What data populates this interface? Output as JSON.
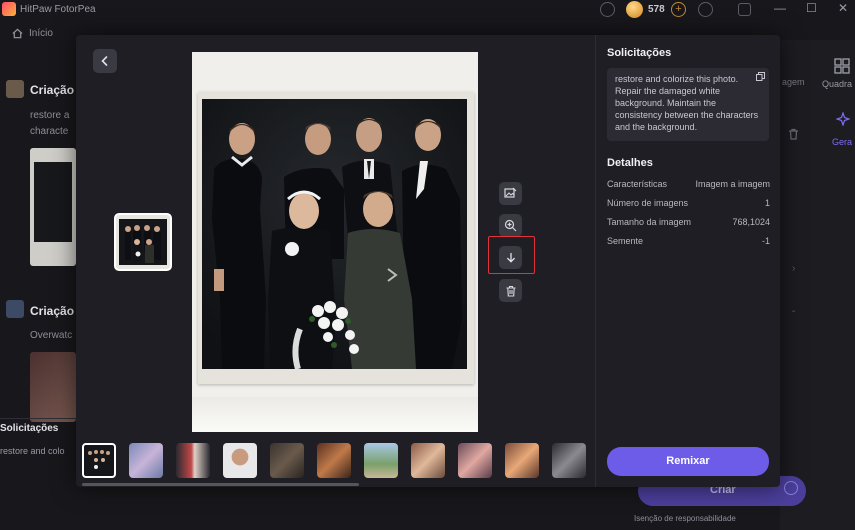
{
  "app": {
    "title": "HitPaw FotorPea",
    "coin_count": "578"
  },
  "nav": {
    "home_label": "Início"
  },
  "background": {
    "section1_title": "Criação",
    "section1_text": [
      "restore a",
      "characte"
    ],
    "section2_title": "Criação",
    "section2_text": "Overwatc",
    "tab_label": "Quadra",
    "tab2_label": "agem",
    "tab3_label": "Gera",
    "create_label": "Criar",
    "disclaimer": "Isenção de responsabilidade",
    "solicitacoes_label": "Solicitações",
    "solicitacoes_text": "restore and colo"
  },
  "modal": {
    "prompt_title": "Solicitações",
    "prompt_text": "restore and colorize this photo. Repair the damaged white background. Maintain the consistency between the characters and the background.",
    "details_title": "Detalhes",
    "details": [
      {
        "label": "Características",
        "value": "Imagem a imagem"
      },
      {
        "label": "Número de imagens",
        "value": "1"
      },
      {
        "label": "Tamanho da imagem",
        "value": "768,1024"
      },
      {
        "label": "Semente",
        "value": "-1"
      }
    ],
    "remix_label": "Remixar"
  },
  "colors": {
    "accent": "#6c5ce7",
    "highlight": "#e2333b",
    "modal_bg": "#1f1e24"
  },
  "icons": [
    "back-arrow-icon",
    "image-edit-icon",
    "zoom-in-icon",
    "download-icon",
    "trash-icon",
    "copy-icon"
  ]
}
